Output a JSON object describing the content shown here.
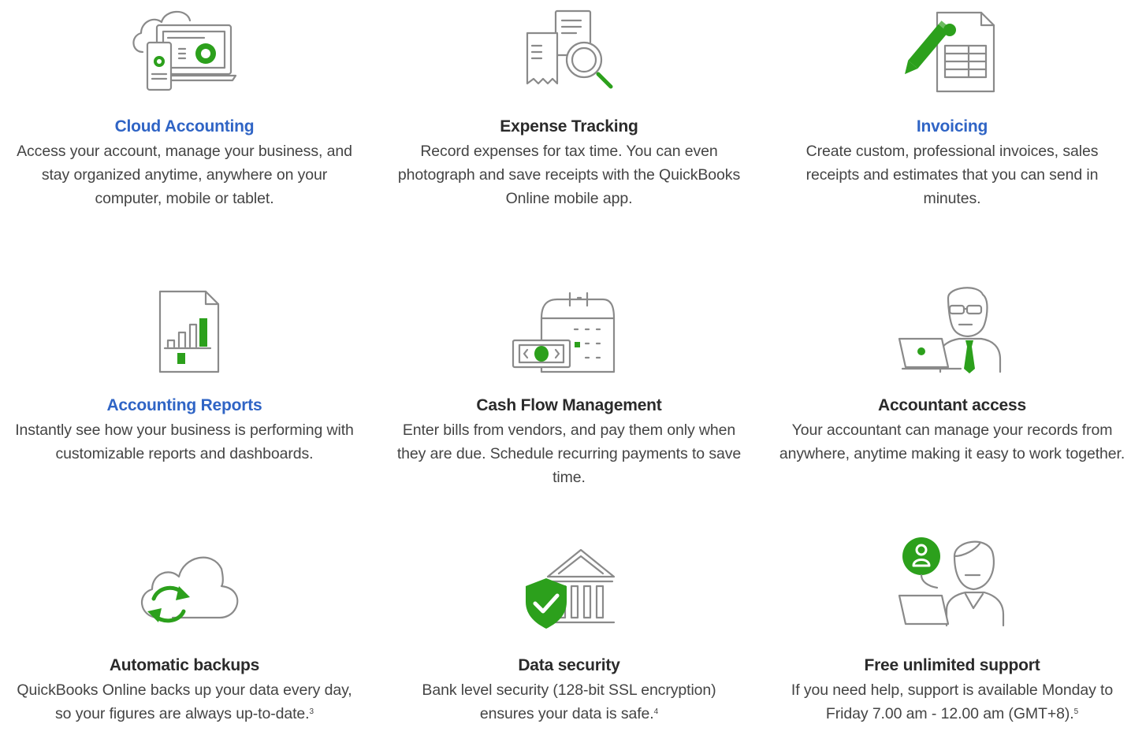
{
  "features": [
    {
      "title": "Cloud Accounting",
      "description": "Access your account, manage your business, and stay organized anytime, anywhere on your computer, mobile or tablet.",
      "icon": "cloud-devices-icon",
      "is_link": true
    },
    {
      "title": "Expense Tracking",
      "description": "Record expenses for tax time. You can even photograph and save receipts with the QuickBooks Online mobile app.",
      "icon": "receipt-magnifier-icon",
      "is_link": false
    },
    {
      "title": "Invoicing",
      "description": "Create custom, professional invoices, sales receipts and estimates that you can send in minutes.",
      "icon": "invoice-pencil-icon",
      "is_link": true
    },
    {
      "title": "Accounting Reports",
      "description": "Instantly see how your business is performing with customizable reports and dashboards.",
      "icon": "report-chart-icon",
      "is_link": true
    },
    {
      "title": "Cash Flow Management",
      "description": "Enter bills from vendors, and pay them only when they are due. Schedule recurring payments to save time.",
      "icon": "calendar-cash-icon",
      "is_link": false
    },
    {
      "title": "Accountant access",
      "description": "Your accountant can manage your records from anywhere, anytime making it easy to work together.",
      "icon": "accountant-laptop-icon",
      "is_link": false
    },
    {
      "title": "Automatic backups",
      "description": "QuickBooks Online backs up your data every day, so your figures are always up-to-date.",
      "footnote": "3",
      "icon": "cloud-sync-icon",
      "is_link": false
    },
    {
      "title": "Data security",
      "description": "Bank level security (128-bit SSL encryption) ensures your data is safe.",
      "footnote": "4",
      "icon": "bank-shield-icon",
      "is_link": false
    },
    {
      "title": "Free unlimited support",
      "description": "If you need help, support is available Monday to Friday 7.00 am - 12.00 am (GMT+8).",
      "footnote": "5",
      "icon": "support-agent-icon",
      "is_link": false
    }
  ],
  "colors": {
    "brand_green": "#2ca01c",
    "link_blue": "#2f64c5",
    "icon_gray": "#8a8a8a"
  }
}
